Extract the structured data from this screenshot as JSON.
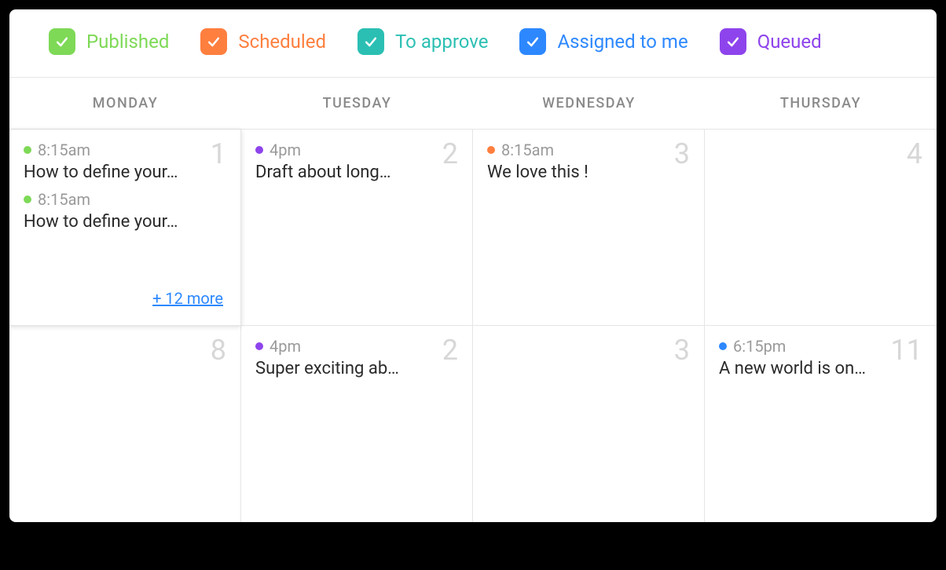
{
  "filters": [
    {
      "label": "Published",
      "color": "#7ed957"
    },
    {
      "label": "Scheduled",
      "color": "#ff7f3f"
    },
    {
      "label": "To approve",
      "color": "#2bbfb3"
    },
    {
      "label": "Assigned to me",
      "color": "#2d88ff"
    },
    {
      "label": "Queued",
      "color": "#8e44ec"
    }
  ],
  "days": [
    "MONDAY",
    "TUESDAY",
    "WEDNESDAY",
    "THURSDAY"
  ],
  "cells": [
    {
      "num": "1",
      "highlight": true,
      "events": [
        {
          "time": "8:15am",
          "title": "How to define your…",
          "dotColor": "#7ed957"
        },
        {
          "time": "8:15am",
          "title": "How to define your…",
          "dotColor": "#7ed957"
        }
      ],
      "more": "+ 12 more"
    },
    {
      "num": "2",
      "events": [
        {
          "time": "4pm",
          "title": "Draft about long…",
          "dotColor": "#8e44ec"
        }
      ]
    },
    {
      "num": "3",
      "events": [
        {
          "time": "8:15am",
          "title": "We love this !",
          "dotColor": "#ff7f3f"
        }
      ]
    },
    {
      "num": "4",
      "events": []
    },
    {
      "num": "8",
      "events": []
    },
    {
      "num": "2",
      "events": [
        {
          "time": "4pm",
          "title": "Super exciting ab…",
          "dotColor": "#8e44ec"
        }
      ]
    },
    {
      "num": "3",
      "events": []
    },
    {
      "num": "11",
      "events": [
        {
          "time": "6:15pm",
          "title": "A new world is on…",
          "dotColor": "#2d88ff"
        }
      ]
    }
  ]
}
